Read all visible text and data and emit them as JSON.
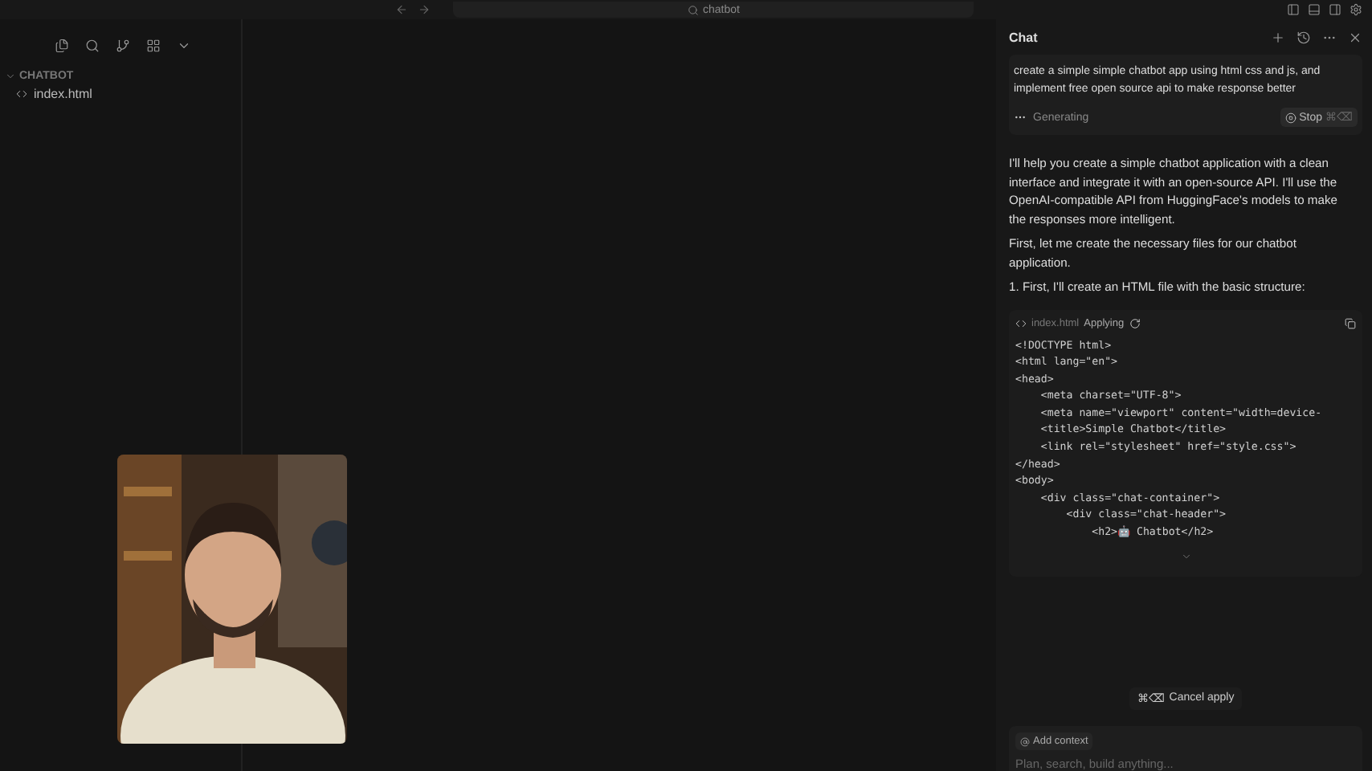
{
  "search": {
    "value": "chatbot"
  },
  "explorer": {
    "folder": "CHATBOT",
    "expanded": true,
    "files": [
      {
        "name": "index.html",
        "selected": false
      }
    ]
  },
  "chat": {
    "title": "Chat",
    "prompt": "create a simple simple chatbot app using html css and js, and implement free open source api to make response better",
    "status": "Generating",
    "stop_label": "Stop",
    "stop_shortcut": "⌘⌫",
    "paragraphs": [
      "I'll help you create a simple chatbot application with a clean interface and integrate it with an open-source API. I'll use the OpenAI-compatible API from HuggingFace's models to make the responses more intelligent.",
      "First, let me create the necessary files for our chatbot application.",
      "1. First, I'll create an HTML file with the basic structure:"
    ],
    "code_block": {
      "file": "index.html",
      "status": "Applying",
      "lines": [
        "<!DOCTYPE html>",
        "<html lang=\"en\">",
        "<head>",
        "    <meta charset=\"UTF-8\">",
        "    <meta name=\"viewport\" content=\"width=device-",
        "    <title>Simple Chatbot</title>",
        "    <link rel=\"stylesheet\" href=\"style.css\">",
        "</head>",
        "<body>",
        "    <div class=\"chat-container\">",
        "        <div class=\"chat-header\">",
        "            <h2>🤖 Chatbot</h2>"
      ]
    },
    "cancel_shortcut": "⌘⌫",
    "cancel_label": "Cancel apply",
    "add_context": "Add context",
    "input": {
      "placeholder": "Plan, search, build anything..."
    }
  }
}
